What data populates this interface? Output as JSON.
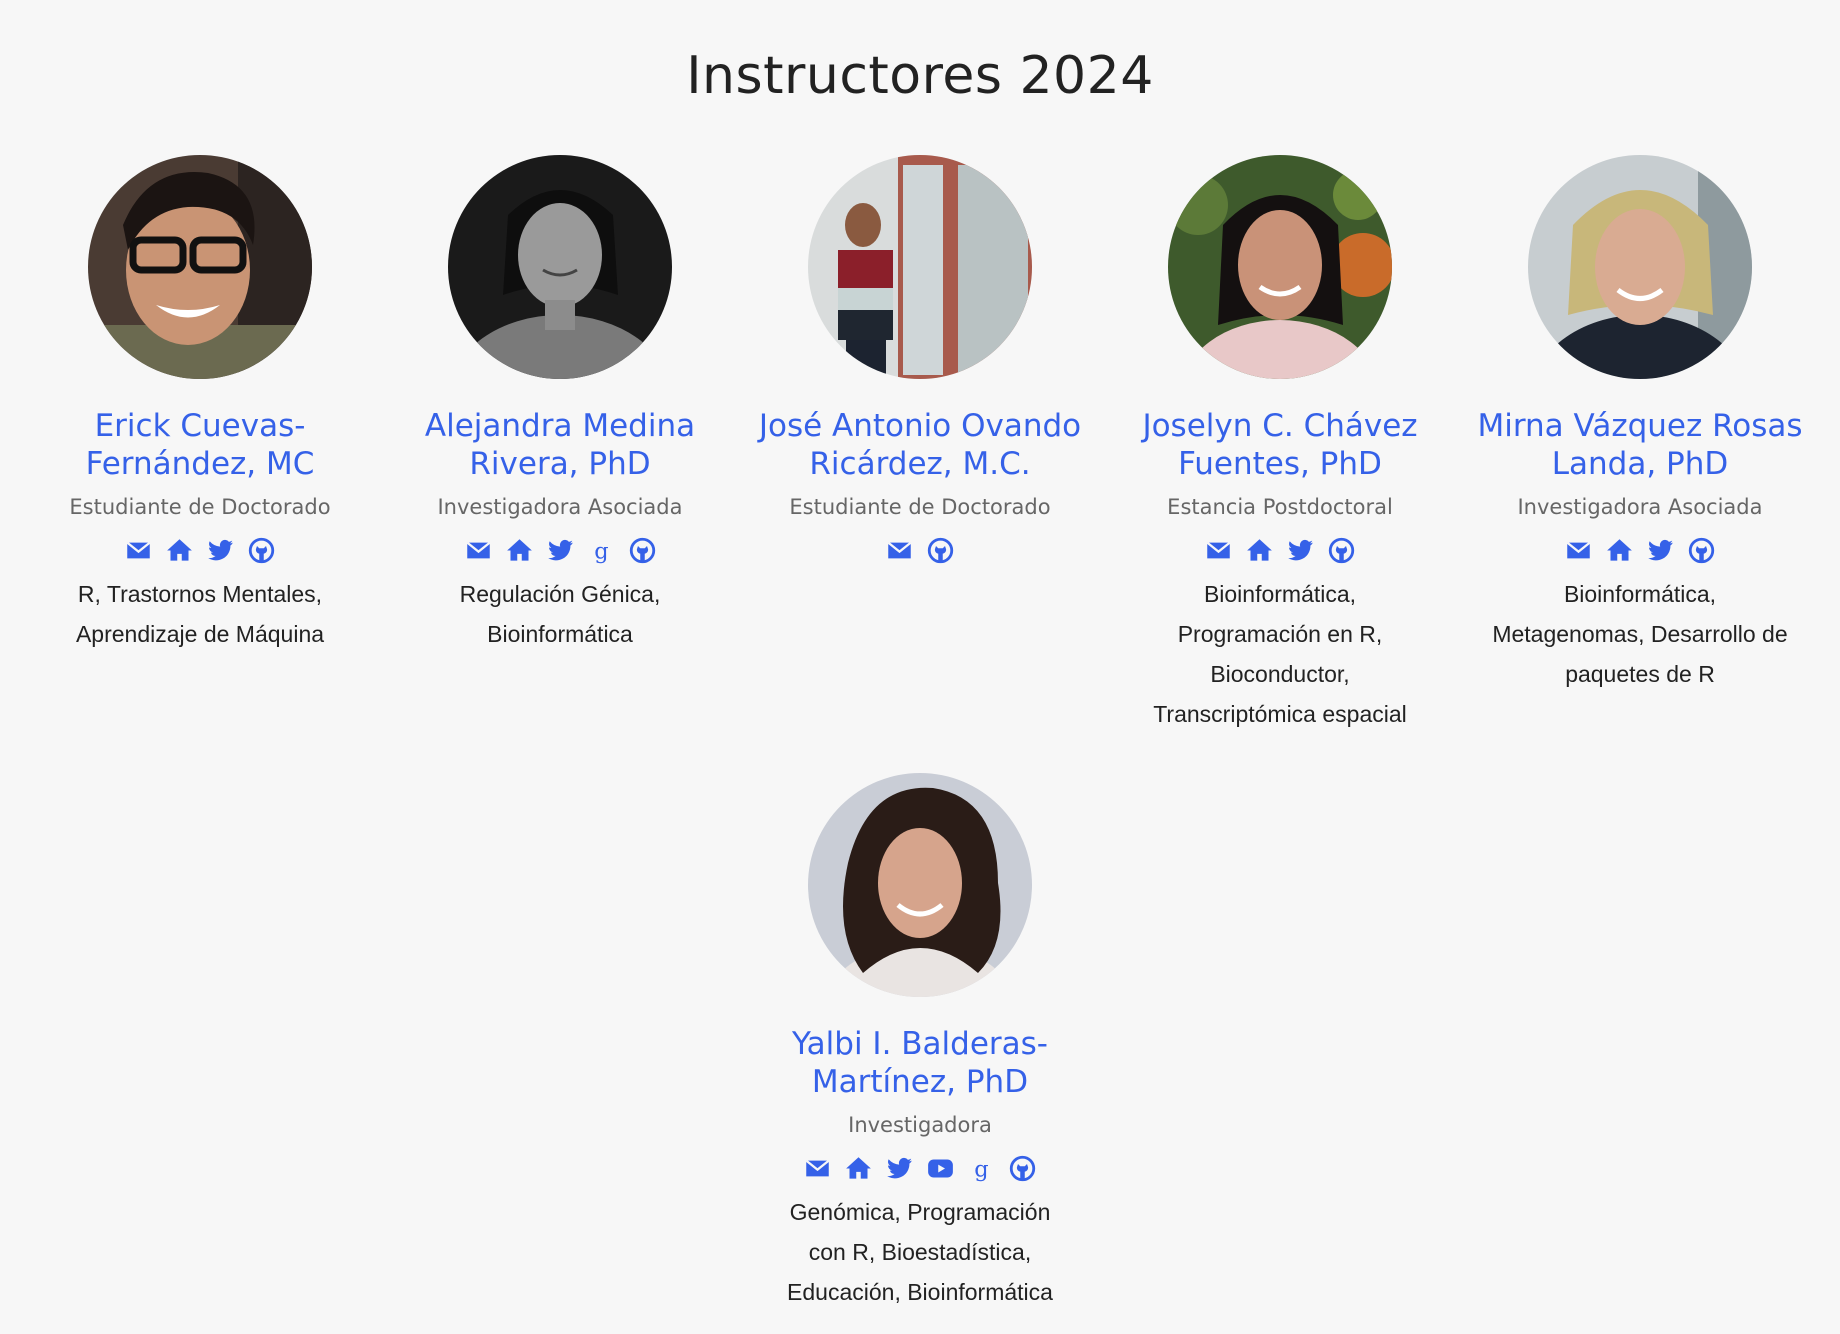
{
  "section": {
    "title": "Instructores 2024"
  },
  "colors": {
    "accent": "#3561e8",
    "background": "#f7f7f7",
    "role_text": "#666666",
    "body_text": "#222222"
  },
  "people": [
    {
      "name": "Erick Cuevas-Fernández, MC",
      "role": "Estudiante de Doctorado",
      "interests": "R, Trastornos Mentales, Aprendizaje de Máquina",
      "icons": [
        "envelope-icon",
        "home-icon",
        "twitter-icon",
        "github-icon"
      ]
    },
    {
      "name": "Alejandra Medina Rivera, PhD",
      "role": "Investigadora Asociada",
      "interests": "Regulación Génica, Bioinformática",
      "icons": [
        "envelope-icon",
        "home-icon",
        "twitter-icon",
        "google-scholar-icon",
        "github-icon"
      ]
    },
    {
      "name": "José Antonio Ovando Ricárdez, M.C.",
      "role": "Estudiante de Doctorado",
      "interests": "",
      "icons": [
        "envelope-icon",
        "github-icon"
      ]
    },
    {
      "name": "Joselyn C. Chávez Fuentes, PhD",
      "role": "Estancia Postdoctoral",
      "interests": "Bioinformática, Programación en R, Bioconductor, Transcriptómica espacial",
      "icons": [
        "envelope-icon",
        "home-icon",
        "twitter-icon",
        "github-icon"
      ]
    },
    {
      "name": "Mirna Vázquez Rosas Landa, PhD",
      "role": "Investigadora Asociada",
      "interests": "Bioinformática, Metagenomas, Desarrollo de paquetes de R",
      "icons": [
        "envelope-icon",
        "home-icon",
        "twitter-icon",
        "github-icon"
      ]
    },
    {
      "name": "Yalbi I. Balderas-Martínez, PhD",
      "role": "Investigadora",
      "interests": "Genómica, Programación con R, Bioestadística, Educación, Bioinformática",
      "icons": [
        "envelope-icon",
        "home-icon",
        "twitter-icon",
        "youtube-icon",
        "google-scholar-icon",
        "github-icon"
      ]
    }
  ]
}
